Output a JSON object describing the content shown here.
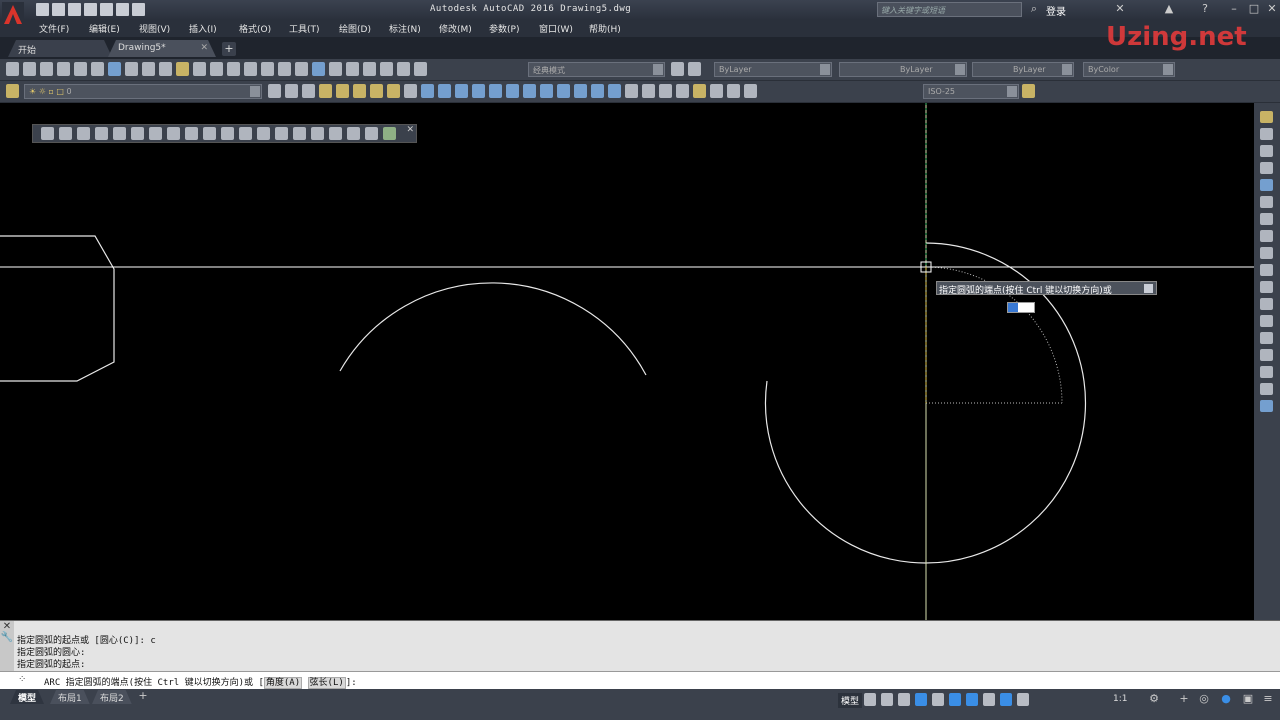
{
  "title": {
    "app_title": "Autodesk AutoCAD 2016    Drawing5.dwg",
    "search_placeholder": "键入关键字或短语",
    "login": "登录",
    "watermark": "Uzing.net"
  },
  "menu": [
    "文件(F)",
    "编辑(E)",
    "视图(V)",
    "插入(I)",
    "格式(O)",
    "工具(T)",
    "绘图(D)",
    "标注(N)",
    "修改(M)",
    "参数(P)",
    "窗口(W)",
    "帮助(H)"
  ],
  "tabs": [
    {
      "label": "开始"
    },
    {
      "label": "Drawing5*"
    }
  ],
  "toolbar": {
    "workspace": "经典模式",
    "color": "ByLayer",
    "linetype": "ByLayer",
    "lineweight": "ByLayer",
    "plotstyle": "ByColor",
    "layer": "0",
    "dimstyle": "ISO-25"
  },
  "canvas": {
    "tooltip": "指定圆弧的端点(按住 Ctrl 键以切换方向)或"
  },
  "command": {
    "history": [
      "指定圆弧的起点或 [圆心(C)]: c",
      "指定圆弧的圆心:",
      "指定圆弧的起点:"
    ],
    "prompt_prefix": "ARC 指定圆弧的端点(按住 Ctrl 键以切换方向)或 [",
    "option_angle": "角度(A)",
    "option_chord": "弦长(L)",
    "prompt_suffix": "]:"
  },
  "status": {
    "layout_tabs": [
      "模型",
      "布局1",
      "布局2"
    ],
    "model_label": "模型",
    "scale": "1:1"
  },
  "colors": {
    "ui_dark": "#3b414c",
    "canvas": "#000000",
    "crosshair": "#ffffff",
    "command_bg": "#e4e4e4"
  }
}
